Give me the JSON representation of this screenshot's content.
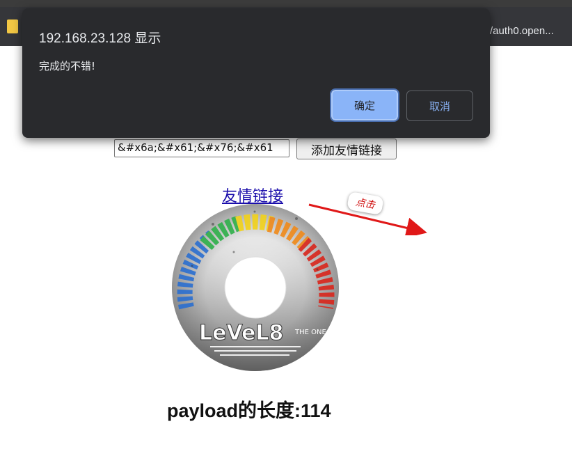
{
  "browser": {
    "bookmark_text": "/auth0.open..."
  },
  "dialog": {
    "title": "192.168.23.128 显示",
    "message": "完成的不错!",
    "ok_label": "确定",
    "cancel_label": "取消"
  },
  "page": {
    "input_value": "&#x6a;&#x61;&#x76;&#x61",
    "add_button_label": "添加友情链接",
    "friend_link_text": "友情链接",
    "click_annotation": "点击",
    "disc_logo_text": "LeVeL8",
    "disc_logo_sub": "THE ONE",
    "payload_length_text": "payload的长度:114"
  },
  "colors": {
    "dialog_bg": "#292a2d",
    "ok_button": "#8ab4f8",
    "link": "#1a0dab",
    "annotation_red": "#d01010"
  }
}
